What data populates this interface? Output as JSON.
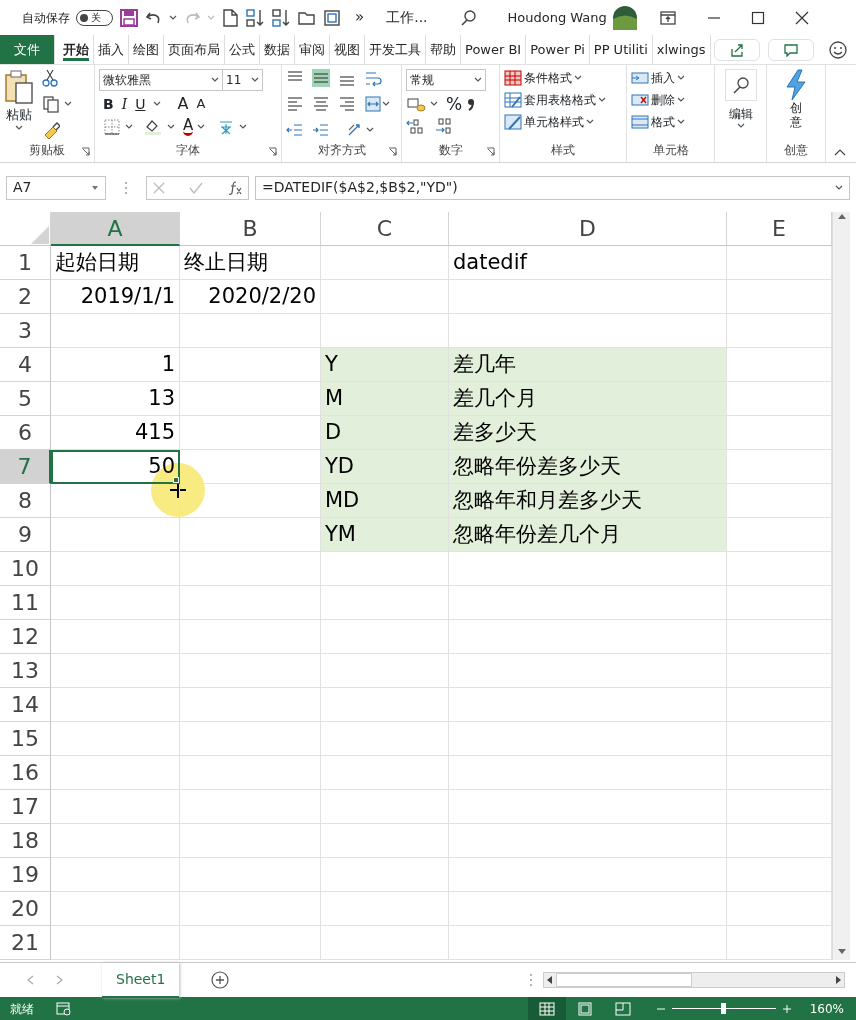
{
  "title_bar": {
    "autosave_label": "自动保存",
    "autosave": {
      "on": false,
      "label": "关"
    },
    "overflow": "»",
    "document_title": "工作...",
    "user_name": "Houdong Wang"
  },
  "ribbon_tabs": [
    {
      "label": "文件",
      "kind": "file",
      "selected": false
    },
    {
      "label": "开始",
      "kind": "tab",
      "selected": true
    },
    {
      "label": "插入",
      "kind": "tab",
      "selected": false
    },
    {
      "label": "绘图",
      "kind": "tab",
      "selected": false
    },
    {
      "label": "页面布局",
      "kind": "tab",
      "selected": false
    },
    {
      "label": "公式",
      "kind": "tab",
      "selected": false
    },
    {
      "label": "数据",
      "kind": "tab",
      "selected": false
    },
    {
      "label": "审阅",
      "kind": "tab",
      "selected": false
    },
    {
      "label": "视图",
      "kind": "tab",
      "selected": false
    },
    {
      "label": "开发工具",
      "kind": "tab",
      "selected": false
    },
    {
      "label": "帮助",
      "kind": "tab",
      "selected": false
    },
    {
      "label": "Power BI",
      "kind": "tab",
      "selected": false
    },
    {
      "label": "Power Pi",
      "kind": "tab",
      "selected": false
    },
    {
      "label": "PP Utiliti",
      "kind": "tab",
      "selected": false
    },
    {
      "label": "xlwings",
      "kind": "tab",
      "selected": false
    }
  ],
  "ribbon": {
    "clipboard": {
      "paste": "粘贴",
      "label": "剪贴板"
    },
    "font": {
      "font_name": "微软雅黑",
      "font_size": "11",
      "bold": "B",
      "italic": "I",
      "underline": "U",
      "grow_font": "A",
      "shrink_font": "A",
      "font_color": "A",
      "label": "字体"
    },
    "alignment": {
      "label": "对齐方式"
    },
    "number": {
      "format": "常规",
      "percent": "%",
      "label": "数字"
    },
    "styles": {
      "items": [
        "条件格式",
        "套用表格格式",
        "单元格样式"
      ],
      "label": "样式"
    },
    "cells": {
      "items": [
        "插入",
        "删除",
        "格式"
      ],
      "label": "单元格"
    },
    "editing": {
      "button": "编辑"
    },
    "ideas": {
      "button": "创意",
      "label": "创意"
    }
  },
  "formula_bar": {
    "name_box": "A7",
    "formula": "=DATEDIF($A$2,$B$2,\"YD\")"
  },
  "columns": [
    {
      "label": "A",
      "selected": true
    },
    {
      "label": "B",
      "selected": false
    },
    {
      "label": "C",
      "selected": false
    },
    {
      "label": "D",
      "selected": false
    },
    {
      "label": "E",
      "selected": false
    }
  ],
  "rows": [
    {
      "header": "1",
      "selected": false,
      "cells": [
        {
          "text": "起始日期",
          "kind": "text",
          "highlighted": false,
          "selected": false
        },
        {
          "text": "终止日期",
          "kind": "text",
          "highlighted": false,
          "selected": false
        },
        {
          "highlighted": false,
          "selected": false
        },
        {
          "text": "datedif",
          "kind": "text",
          "highlighted": false,
          "selected": false
        },
        {
          "highlighted": false,
          "selected": false
        }
      ]
    },
    {
      "header": "2",
      "selected": false,
      "cells": [
        {
          "text": "2019/1/1",
          "kind": "number",
          "highlighted": false,
          "selected": false
        },
        {
          "text": "2020/2/20",
          "kind": "number",
          "highlighted": false,
          "selected": false
        },
        {
          "highlighted": false,
          "selected": false
        },
        {
          "highlighted": false,
          "selected": false
        },
        {
          "highlighted": false,
          "selected": false
        }
      ]
    },
    {
      "header": "3",
      "selected": false,
      "cells": [
        {
          "highlighted": false,
          "selected": false
        },
        {
          "highlighted": false,
          "selected": false
        },
        {
          "highlighted": false,
          "selected": false
        },
        {
          "highlighted": false,
          "selected": false
        },
        {
          "highlighted": false,
          "selected": false
        }
      ]
    },
    {
      "header": "4",
      "selected": false,
      "cells": [
        {
          "text": "1",
          "kind": "number",
          "highlighted": false,
          "selected": false
        },
        {
          "highlighted": false,
          "selected": false
        },
        {
          "text": "Y",
          "kind": "text",
          "highlighted": true,
          "selected": false
        },
        {
          "text": "差几年",
          "kind": "text",
          "highlighted": true,
          "selected": false
        },
        {
          "highlighted": false,
          "selected": false
        }
      ]
    },
    {
      "header": "5",
      "selected": false,
      "cells": [
        {
          "text": "13",
          "kind": "number",
          "highlighted": false,
          "selected": false
        },
        {
          "highlighted": false,
          "selected": false
        },
        {
          "text": "M",
          "kind": "text",
          "highlighted": true,
          "selected": false
        },
        {
          "text": "差几个月",
          "kind": "text",
          "highlighted": true,
          "selected": false
        },
        {
          "highlighted": false,
          "selected": false
        }
      ]
    },
    {
      "header": "6",
      "selected": false,
      "cells": [
        {
          "text": "415",
          "kind": "number",
          "highlighted": false,
          "selected": false
        },
        {
          "highlighted": false,
          "selected": false
        },
        {
          "text": "D",
          "kind": "text",
          "highlighted": true,
          "selected": false
        },
        {
          "text": "差多少天",
          "kind": "text",
          "highlighted": true,
          "selected": false
        },
        {
          "highlighted": false,
          "selected": false
        }
      ]
    },
    {
      "header": "7",
      "selected": true,
      "cells": [
        {
          "text": "50",
          "kind": "number",
          "highlighted": false,
          "selected": true
        },
        {
          "highlighted": false,
          "selected": false
        },
        {
          "text": "YD",
          "kind": "text",
          "highlighted": true,
          "selected": false
        },
        {
          "text": "忽略年份差多少天",
          "kind": "text",
          "highlighted": true,
          "selected": false
        },
        {
          "highlighted": false,
          "selected": false
        }
      ]
    },
    {
      "header": "8",
      "selected": false,
      "cells": [
        {
          "highlighted": false,
          "selected": false
        },
        {
          "highlighted": false,
          "selected": false
        },
        {
          "text": "MD",
          "kind": "text",
          "highlighted": true,
          "selected": false
        },
        {
          "text": "忽略年和月差多少天",
          "kind": "text",
          "highlighted": true,
          "selected": false
        },
        {
          "highlighted": false,
          "selected": false
        }
      ]
    },
    {
      "header": "9",
      "selected": false,
      "cells": [
        {
          "highlighted": false,
          "selected": false
        },
        {
          "highlighted": false,
          "selected": false
        },
        {
          "text": "YM",
          "kind": "text",
          "highlighted": true,
          "selected": false
        },
        {
          "text": "忽略年份差几个月",
          "kind": "text",
          "highlighted": true,
          "selected": false
        },
        {
          "highlighted": false,
          "selected": false
        }
      ]
    },
    {
      "header": "10",
      "selected": false,
      "cells": []
    },
    {
      "header": "11",
      "selected": false,
      "cells": []
    },
    {
      "header": "12",
      "selected": false,
      "cells": []
    },
    {
      "header": "13",
      "selected": false,
      "cells": []
    },
    {
      "header": "14",
      "selected": false,
      "cells": []
    },
    {
      "header": "15",
      "selected": false,
      "cells": []
    },
    {
      "header": "16",
      "selected": false,
      "cells": []
    },
    {
      "header": "17",
      "selected": false,
      "cells": []
    },
    {
      "header": "18",
      "selected": false,
      "cells": []
    },
    {
      "header": "19",
      "selected": false,
      "cells": []
    },
    {
      "header": "20",
      "selected": false,
      "cells": []
    },
    {
      "header": "21",
      "selected": false,
      "cells": []
    }
  ],
  "sheet_tabs": [
    {
      "label": "Sheet1",
      "selected": true
    }
  ],
  "status_bar": {
    "status": "就绪",
    "views": [
      {
        "kind": "normal",
        "selected": true
      },
      {
        "kind": "page_layout",
        "selected": false
      },
      {
        "kind": "page_break",
        "selected": false
      }
    ],
    "zoom": {
      "level": 0.5,
      "reading": "160%"
    }
  }
}
